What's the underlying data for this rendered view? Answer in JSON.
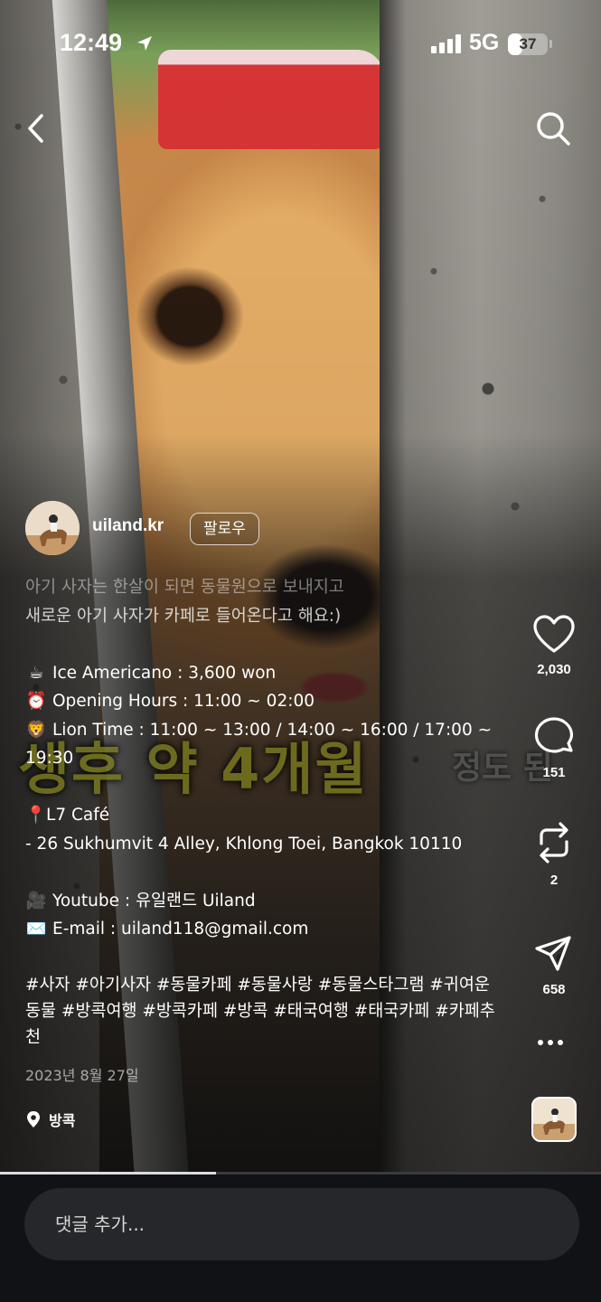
{
  "status_bar": {
    "time": "12:49",
    "network": "5G",
    "battery": "37",
    "battery_level": 0.37
  },
  "author": {
    "username": "uiland.kr",
    "follow_label": "팔로우"
  },
  "video_overlay": {
    "subtitle_main": "생후 약 4개월",
    "subtitle_small": "정도 된"
  },
  "caption": {
    "intro_line1": "아기 사자는 한살이 되면 동물원으로 보내지고",
    "intro_line2": "새로운 아기 사자가 카페로 들어온다고 해요:)",
    "menu": [
      {
        "emoji": "☕",
        "text": "Ice Americano : 3,600 won"
      },
      {
        "emoji": "⏰",
        "text": "Opening Hours : 11:00 ~ 02:00"
      },
      {
        "emoji": "🦁",
        "text": "Lion Time : 11:00 ~ 13:00 / 14:00 ~ 16:00 / 17:00 ~ 19:30"
      }
    ],
    "place_emoji": "📍",
    "place_name": "L7 Café",
    "place_address": " -  26 Sukhumvit 4 Alley, Khlong Toei, Bangkok 10110",
    "contacts": [
      {
        "emoji": "🎥",
        "text": "Youtube : 유일랜드 Uiland"
      },
      {
        "emoji": "✉️",
        "text": "E-mail : uiland118@gmail.com"
      }
    ],
    "hashtags": "#사자 #아기사자 #동물카페 #동물사랑 #동물스타그램 #귀여운동물 #방콕여행 #방콕카페 #방콕 #태국여행 #태국카페 #카페추천"
  },
  "post": {
    "date": "2023년 8월 27일",
    "location": "방콕"
  },
  "actions": {
    "likes": "2,030",
    "comments": "151",
    "reposts": "2",
    "shares": "658"
  },
  "video_progress": 0.36,
  "comment_box": {
    "placeholder": "댓글 추가..."
  },
  "colors": {
    "background": "#111214",
    "input_bg": "#25272b",
    "subtitle": "#7a7a1e"
  },
  "icons": [
    "location-arrow-icon",
    "back-chevron-icon",
    "search-icon",
    "heart-icon",
    "comment-icon",
    "repost-icon",
    "send-icon",
    "more-icon",
    "location-pin-icon"
  ]
}
